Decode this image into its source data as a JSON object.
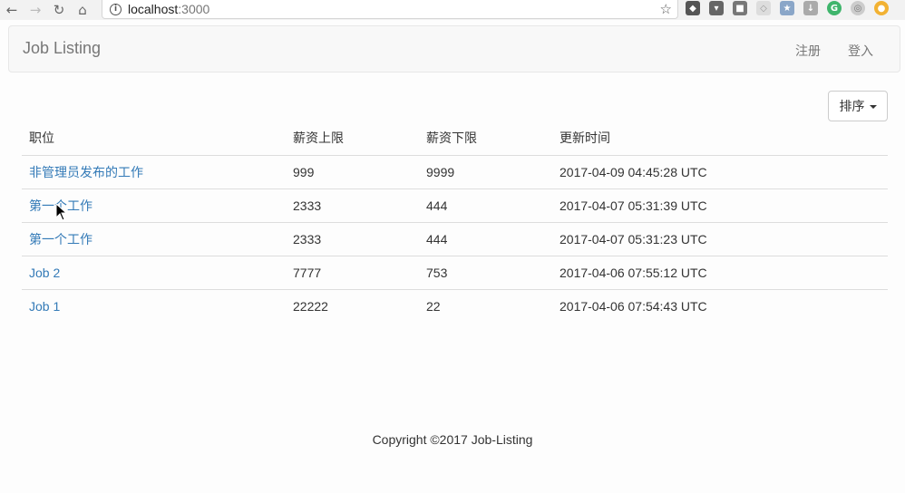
{
  "browser": {
    "url_host": "localhost",
    "url_port": ":3000"
  },
  "navbar": {
    "brand": "Job Listing",
    "register": "注册",
    "login": "登入"
  },
  "sort": {
    "label": "排序"
  },
  "table": {
    "headers": [
      "职位",
      "薪资上限",
      "薪资下限",
      "更新时间"
    ],
    "rows": [
      {
        "title": "非管理员发布的工作",
        "wage_upper": "999",
        "wage_lower": "9999",
        "updated": "2017-04-09 04:45:28 UTC"
      },
      {
        "title": "第一个工作",
        "wage_upper": "2333",
        "wage_lower": "444",
        "updated": "2017-04-07 05:31:39 UTC"
      },
      {
        "title": "第一个工作",
        "wage_upper": "2333",
        "wage_lower": "444",
        "updated": "2017-04-07 05:31:23 UTC"
      },
      {
        "title": "Job 2",
        "wage_upper": "7777",
        "wage_lower": "753",
        "updated": "2017-04-06 07:55:12 UTC"
      },
      {
        "title": "Job 1",
        "wage_upper": "22222",
        "wage_lower": "22",
        "updated": "2017-04-06 07:54:43 UTC"
      }
    ]
  },
  "footer": {
    "text": "Copyright ©2017 Job-Listing"
  },
  "icons": {
    "back": "arrow-left-icon",
    "forward": "arrow-right-icon",
    "reload": "reload-icon",
    "home": "home-icon",
    "info": "info-icon",
    "bookmark": "star-icon",
    "caret": "caret-down-icon"
  },
  "colors": {
    "link": "#337ab7",
    "navbar_bg": "#f8f8f8",
    "muted": "#777777"
  }
}
